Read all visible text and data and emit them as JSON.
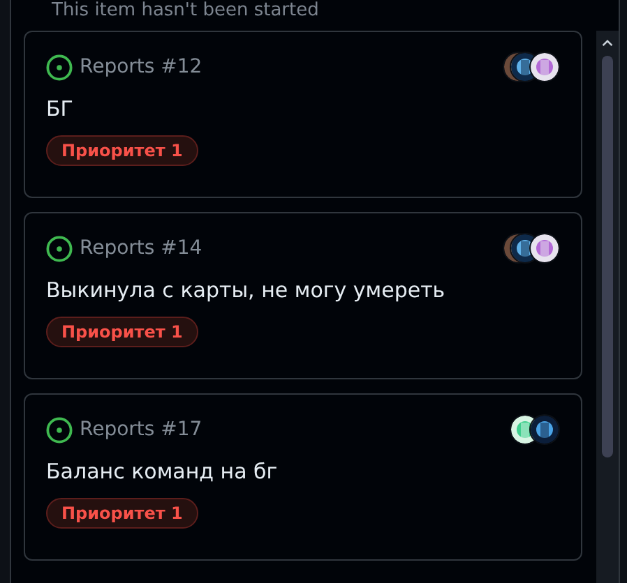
{
  "column_status_text": "This item hasn't been started",
  "cards": [
    {
      "reference": "Reports #12",
      "title": "БГ",
      "label": {
        "text": "Приоритет 1"
      }
    },
    {
      "reference": "Reports #14",
      "title": "Выкинула с карты, не могу умереть",
      "label": {
        "text": "Приоритет 1"
      }
    },
    {
      "reference": "Reports #17",
      "title": "Баланс команд на бг",
      "label": {
        "text": "Приоритет 1"
      }
    }
  ]
}
